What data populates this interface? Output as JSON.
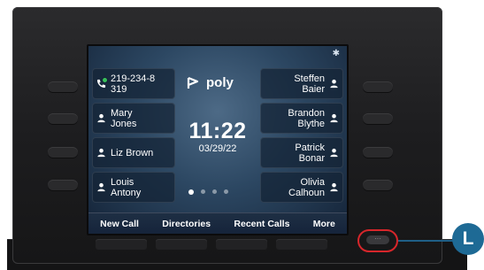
{
  "screen": {
    "status_icons": {
      "bluetooth": "bluetooth-icon"
    },
    "logo": {
      "text": "poly"
    },
    "clock": {
      "time": "11:22",
      "date": "03/29/22"
    },
    "line_keys_left": [
      {
        "label": "219-234-8\n319",
        "icon": "phone-line-icon"
      },
      {
        "label": "Mary\nJones",
        "icon": "contact-icon"
      },
      {
        "label": "Liz Brown",
        "icon": "contact-icon"
      },
      {
        "label": "Louis\nAntony",
        "icon": "contact-icon"
      }
    ],
    "line_keys_right": [
      {
        "label": "Steffen\nBaier",
        "icon": "contact-icon"
      },
      {
        "label": "Brandon\nBlythe",
        "icon": "contact-icon"
      },
      {
        "label": "Patrick\nBonar",
        "icon": "contact-icon"
      },
      {
        "label": "Olivia\nCalhoun",
        "icon": "contact-icon"
      }
    ],
    "page_indicator": {
      "pages": 4,
      "current": 1
    },
    "softkeys": [
      "New Call",
      "Directories",
      "Recent Calls",
      "More"
    ]
  },
  "callout": {
    "label": "L"
  },
  "colors": {
    "screen_bg": "#2c4762",
    "presence_online": "#38c15a",
    "highlight_ring": "#d7262b",
    "callout_blue": "#1e6a95"
  }
}
